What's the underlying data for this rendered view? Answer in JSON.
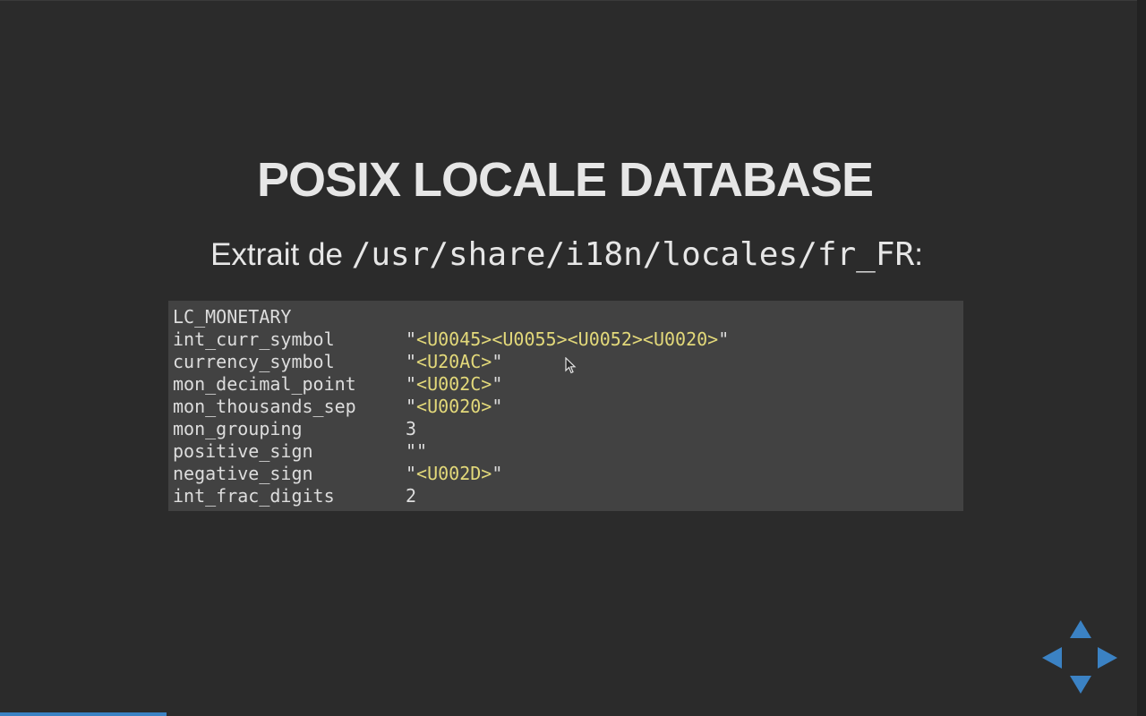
{
  "slide": {
    "title": "POSIX LOCALE DATABASE",
    "subtitle_prefix": "Extrait de ",
    "subtitle_path": "/usr/share/i18n/locales/fr_FR",
    "subtitle_suffix": ":"
  },
  "code": {
    "header": "LC_MONETARY",
    "lines": [
      {
        "key": "int_curr_symbol",
        "value_parts": [
          "\"",
          "<U0045><U0055><U0052><U0020>",
          "\""
        ]
      },
      {
        "key": "currency_symbol",
        "value_parts": [
          "\"",
          "<U20AC>",
          "\""
        ]
      },
      {
        "key": "mon_decimal_point",
        "value_parts": [
          "\"",
          "<U002C>",
          "\""
        ]
      },
      {
        "key": "mon_thousands_sep",
        "value_parts": [
          "\"",
          "<U0020>",
          "\""
        ]
      },
      {
        "key": "mon_grouping",
        "value_parts": [
          "3",
          "",
          ""
        ]
      },
      {
        "key": "positive_sign",
        "value_parts": [
          "\"\"",
          "",
          ""
        ]
      },
      {
        "key": "negative_sign",
        "value_parts": [
          "\"",
          "<U002D>",
          "\""
        ]
      },
      {
        "key": "int_frac_digits",
        "value_parts": [
          "2",
          "",
          ""
        ]
      }
    ]
  },
  "navigation": {
    "up_icon": "arrow-up-icon",
    "down_icon": "arrow-down-icon",
    "left_icon": "arrow-left-icon",
    "right_icon": "arrow-right-icon",
    "color": "#3b82c4"
  },
  "progress": {
    "fraction": 0.145,
    "color": "#3b82c4"
  },
  "colors": {
    "background": "#2b2b2b",
    "code_background": "#424242",
    "string_highlight": "#e3d97a"
  }
}
